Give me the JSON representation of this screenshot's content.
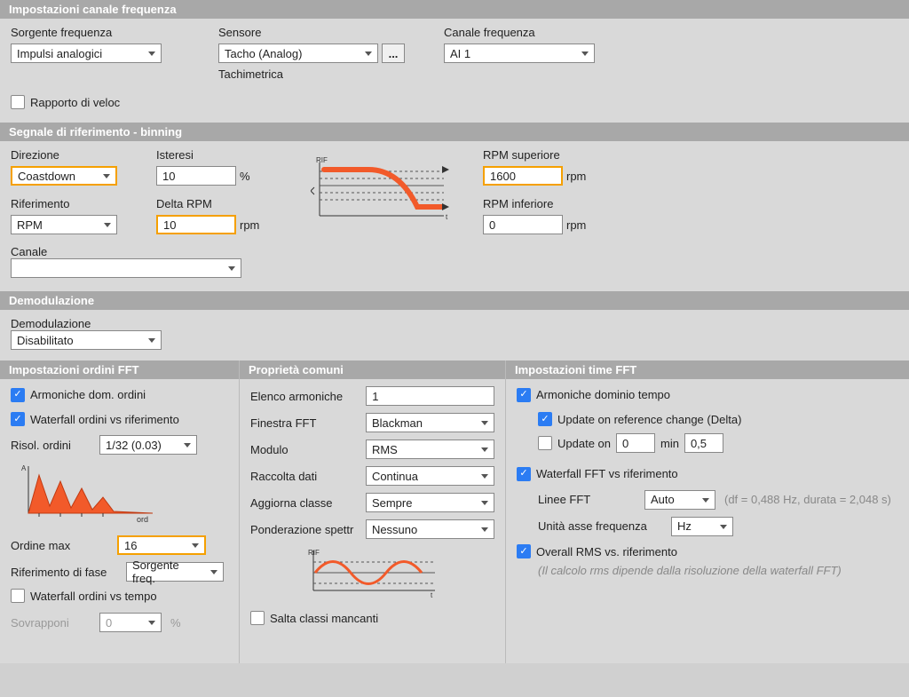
{
  "freq": {
    "header": "Impostazioni canale frequenza",
    "source_lbl": "Sorgente frequenza",
    "source_val": "Impulsi analogici",
    "sensor_lbl": "Sensore",
    "sensor_val": "Tacho (Analog)",
    "sensor_sub": "Tachimetrica",
    "channel_lbl": "Canale frequenza",
    "channel_val": "AI 1",
    "ratio_lbl": "Rapporto di veloc"
  },
  "ref": {
    "header": "Segnale di riferimento - binning",
    "dir_lbl": "Direzione",
    "dir_val": "Coastdown",
    "hyst_lbl": "Isteresi",
    "hyst_val": "10",
    "hyst_unit": "%",
    "ref_lbl": "Riferimento",
    "ref_val": "RPM",
    "delta_lbl": "Delta RPM",
    "delta_val": "10",
    "delta_unit": "rpm",
    "upper_lbl": "RPM superiore",
    "upper_val": "1600",
    "upper_unit": "rpm",
    "lower_lbl": "RPM inferiore",
    "lower_val": "0",
    "lower_unit": "rpm",
    "canale_lbl": "Canale",
    "canale_val": ""
  },
  "demod": {
    "header": "Demodulazione",
    "lbl": "Demodulazione",
    "val": "Disabilitato"
  },
  "ord": {
    "header": "Impostazioni ordini FFT",
    "harm_lbl": "Armoniche dom. ordini",
    "wf_ref_lbl": "Waterfall ordini vs riferimento",
    "res_lbl": "Risol. ordini",
    "res_val": "1/32 (0.03)",
    "ordmax_lbl": "Ordine max",
    "ordmax_val": "16",
    "phase_lbl": "Riferimento di fase",
    "phase_val": "Sorgente freq.",
    "wf_time_lbl": "Waterfall ordini vs tempo",
    "overlap_lbl": "Sovrapponi",
    "overlap_val": "0",
    "overlap_unit": "%"
  },
  "common": {
    "header": "Proprietà comuni",
    "harm_list_lbl": "Elenco armoniche",
    "harm_list_val": "1",
    "window_lbl": "Finestra FFT",
    "window_val": "Blackman",
    "mod_lbl": "Modulo",
    "mod_val": "RMS",
    "coll_lbl": "Raccolta dati",
    "coll_val": "Continua",
    "upd_lbl": "Aggiorna classe",
    "upd_val": "Sempre",
    "weight_lbl": "Ponderazione spettr",
    "weight_val": "Nessuno",
    "skip_lbl": "Salta classi mancanti"
  },
  "time": {
    "header": "Impostazioni time FFT",
    "harm_lbl": "Armoniche dominio tempo",
    "upd_ref_lbl": "Update on reference change (Delta)",
    "upd_on_lbl": "Update on",
    "upd_on_val": "0",
    "upd_on_unit": "min",
    "upd_on_val2": "0,5",
    "wf_lbl": "Waterfall FFT vs riferimento",
    "lines_lbl": "Linee FFT",
    "lines_val": "Auto",
    "lines_hint": "(df = 0,488 Hz, durata = 2,048 s)",
    "unit_lbl": "Unità asse frequenza",
    "unit_val": "Hz",
    "rms_lbl": "Overall RMS vs. riferimento",
    "rms_hint": "(Il calcolo rms dipende dalla risoluzione della waterfall FFT)"
  }
}
